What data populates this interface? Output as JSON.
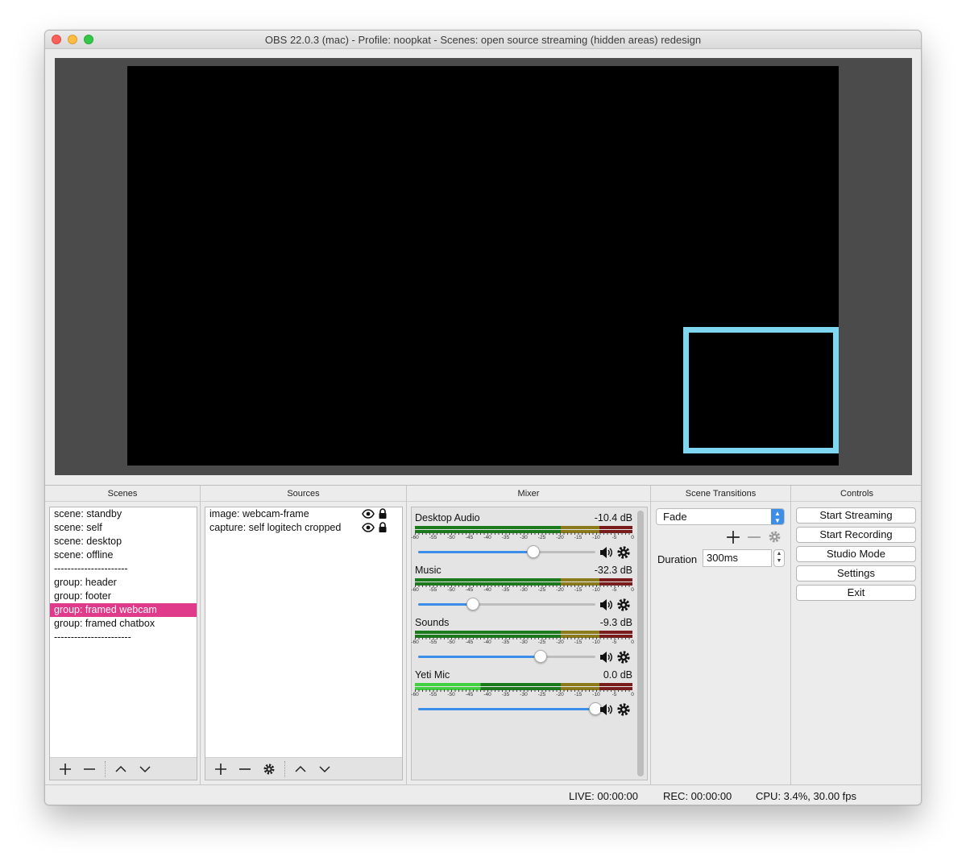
{
  "window": {
    "title": "OBS 22.0.3 (mac) - Profile: noopkat - Scenes: open source streaming (hidden areas) redesign"
  },
  "colors": {
    "selection": "#e03b8b",
    "webcam_frame": "#7fd6f0",
    "accent": "#3d8ee8"
  },
  "scenes": {
    "title": "Scenes",
    "items": [
      {
        "label": "scene: standby"
      },
      {
        "label": "scene: self"
      },
      {
        "label": "scene: desktop"
      },
      {
        "label": "scene: offline"
      },
      {
        "label": "----------------------"
      },
      {
        "label": "group: header"
      },
      {
        "label": "group: footer"
      },
      {
        "label": "group: framed webcam",
        "selected": true
      },
      {
        "label": "group: framed chatbox"
      },
      {
        "label": "-----------------------"
      }
    ]
  },
  "sources": {
    "title": "Sources",
    "items": [
      {
        "label": "image: webcam-frame"
      },
      {
        "label": "capture: self logitech cropped"
      }
    ]
  },
  "mixer": {
    "title": "Mixer",
    "tick_labels": [
      "-60",
      "-55",
      "-50",
      "-45",
      "-40",
      "-35",
      "-30",
      "-25",
      "-20",
      "-15",
      "-10",
      "-5",
      "0"
    ],
    "channels": [
      {
        "name": "Desktop Audio",
        "db": "-10.4 dB",
        "volume": 0.65
      },
      {
        "name": "Music",
        "db": "-32.3 dB",
        "volume": 0.31
      },
      {
        "name": "Sounds",
        "db": "-9.3 dB",
        "volume": 0.69
      },
      {
        "name": "Yeti Mic",
        "db": "0.0 dB",
        "volume": 1.0,
        "active": true
      }
    ]
  },
  "transitions": {
    "title": "Scene Transitions",
    "selected": "Fade",
    "duration_label": "Duration",
    "duration_value": "300ms"
  },
  "controls": {
    "title": "Controls",
    "buttons": [
      {
        "label": "Start Streaming"
      },
      {
        "label": "Start Recording"
      },
      {
        "label": "Studio Mode"
      },
      {
        "label": "Settings"
      },
      {
        "label": "Exit"
      }
    ]
  },
  "status": {
    "live": "LIVE: 00:00:00",
    "rec": "REC: 00:00:00",
    "cpu": "CPU: 3.4%, 30.00 fps"
  }
}
